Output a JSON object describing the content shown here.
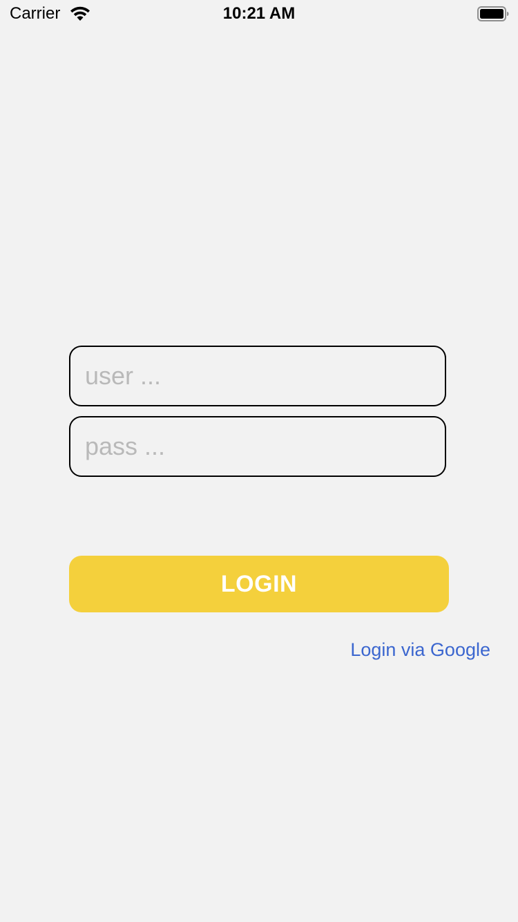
{
  "status_bar": {
    "carrier": "Carrier",
    "time": "10:21 AM",
    "wifi_icon": "wifi-icon",
    "battery_icon": "battery-icon"
  },
  "form": {
    "user_placeholder": "user ...",
    "user_value": "",
    "pass_placeholder": "pass ...",
    "pass_value": "",
    "login_label": "LOGIN",
    "google_link_label": "Login via Google"
  },
  "colors": {
    "background": "#f2f2f2",
    "login_button": "#f4d03c",
    "link": "#3b66cf",
    "placeholder": "#b9b9b9"
  }
}
